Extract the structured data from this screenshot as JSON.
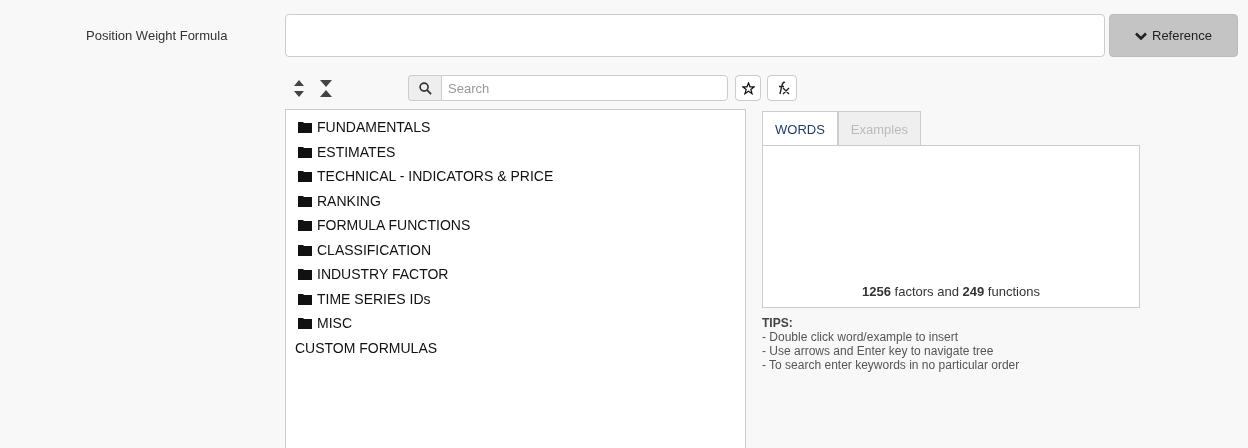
{
  "formula": {
    "label": "Position Weight Formula"
  },
  "reference_button": {
    "label": "Reference"
  },
  "search": {
    "placeholder": "Search"
  },
  "tree": [
    {
      "kind": "folder",
      "label": "FUNDAMENTALS"
    },
    {
      "kind": "folder",
      "label": "ESTIMATES"
    },
    {
      "kind": "folder",
      "label": "TECHNICAL - INDICATORS & PRICE"
    },
    {
      "kind": "folder",
      "label": "RANKING"
    },
    {
      "kind": "folder",
      "label": "FORMULA FUNCTIONS"
    },
    {
      "kind": "folder",
      "label": "CLASSIFICATION"
    },
    {
      "kind": "folder",
      "label": "INDUSTRY FACTOR"
    },
    {
      "kind": "folder",
      "label": "TIME SERIES IDs"
    },
    {
      "kind": "folder",
      "label": "MISC"
    },
    {
      "kind": "plain",
      "label": "CUSTOM FORMULAS"
    }
  ],
  "tabs": [
    {
      "label": "WORDS",
      "selected": true
    },
    {
      "label": "Examples",
      "selected": false
    }
  ],
  "counts": "**1256** factors and **249** functions",
  "tips": {
    "title": "TIPS:",
    "lines": [
      "- Double click word/example to insert",
      "- Use arrows and Enter key to navigate tree",
      "- To search enter keywords in no particular order"
    ]
  }
}
